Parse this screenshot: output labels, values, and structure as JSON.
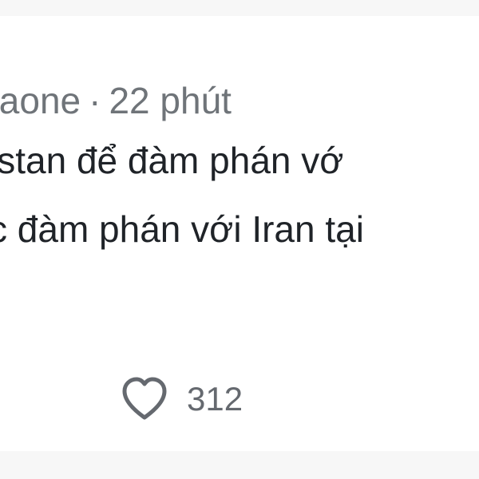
{
  "post": {
    "username_fragment": "taone",
    "separator": "·",
    "time": "22 phút",
    "lines": [
      "istan để đàm phán vớ",
      "c đàm phán với Iran tại"
    ]
  },
  "actions": {
    "like_count": "312",
    "like_icon": "heart-outline-icon"
  },
  "colors": {
    "background": "#ffffff",
    "muted_band": "#f7f7f7",
    "text": "#1f2328",
    "meta_text": "#6f7479",
    "icon": "#65696f"
  }
}
